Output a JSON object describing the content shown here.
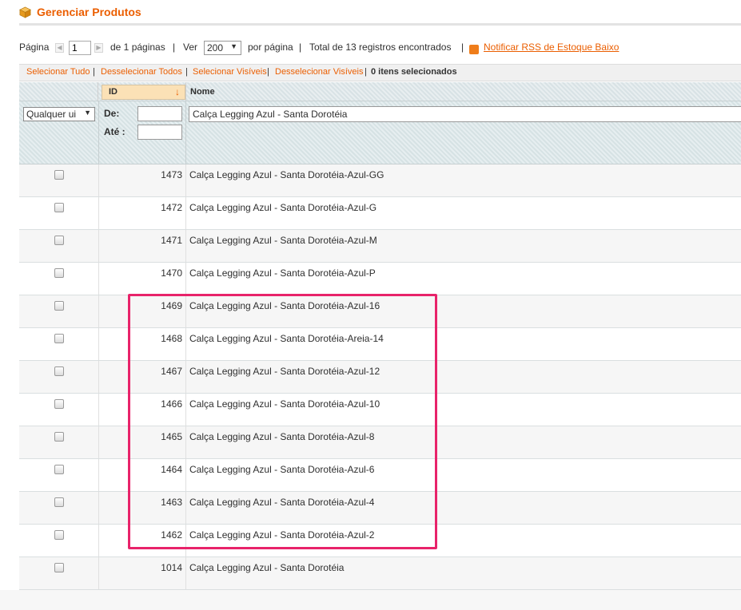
{
  "header": {
    "title": "Gerenciar Produtos",
    "icon": "box-icon"
  },
  "pager": {
    "page_label": "Página",
    "page_value": "1",
    "of_pages": "de 1 páginas",
    "view_label": "Ver",
    "per_page_value": "200",
    "per_page_label": "por página",
    "total": "Total de 13 registros encontrados",
    "rss_link": "Notificar RSS de Estoque Baixo",
    "separator": "|"
  },
  "massaction": {
    "select_all": "Selecionar Tudo",
    "unselect_all": "Desselecionar Todos",
    "select_visible": "Selecionar Visíveis",
    "unselect_visible": "Desselecionar Visíveis",
    "selected_count": "0 itens selecionados",
    "separator": "|"
  },
  "grid": {
    "columns": {
      "id": "ID",
      "name": "Nome",
      "sort_icon": "↓"
    },
    "filter": {
      "select_value": "Qualquer ui",
      "from_label": "De:",
      "to_label": "Até :",
      "name_value": "Calça Legging Azul - Santa Dorotéia"
    },
    "rows": [
      {
        "id": "1473",
        "name": "Calça Legging Azul - Santa Dorotéia-Azul-GG"
      },
      {
        "id": "1472",
        "name": "Calça Legging Azul - Santa Dorotéia-Azul-G"
      },
      {
        "id": "1471",
        "name": "Calça Legging Azul - Santa Dorotéia-Azul-M"
      },
      {
        "id": "1470",
        "name": "Calça Legging Azul - Santa Dorotéia-Azul-P"
      },
      {
        "id": "1469",
        "name": "Calça Legging Azul - Santa Dorotéia-Azul-16"
      },
      {
        "id": "1468",
        "name": "Calça Legging Azul - Santa Dorotéia-Areia-14"
      },
      {
        "id": "1467",
        "name": "Calça Legging Azul - Santa Dorotéia-Azul-12"
      },
      {
        "id": "1466",
        "name": "Calça Legging Azul - Santa Dorotéia-Azul-10"
      },
      {
        "id": "1465",
        "name": "Calça Legging Azul - Santa Dorotéia-Azul-8"
      },
      {
        "id": "1464",
        "name": "Calça Legging Azul - Santa Dorotéia-Azul-6"
      },
      {
        "id": "1463",
        "name": "Calça Legging Azul - Santa Dorotéia-Azul-4"
      },
      {
        "id": "1462",
        "name": "Calça Legging Azul - Santa Dorotéia-Azul-2"
      },
      {
        "id": "1014",
        "name": "Calça Legging Azul - Santa Dorotéia"
      }
    ]
  },
  "colors": {
    "accent": "#eb5e00",
    "highlight": "#e8236a"
  }
}
